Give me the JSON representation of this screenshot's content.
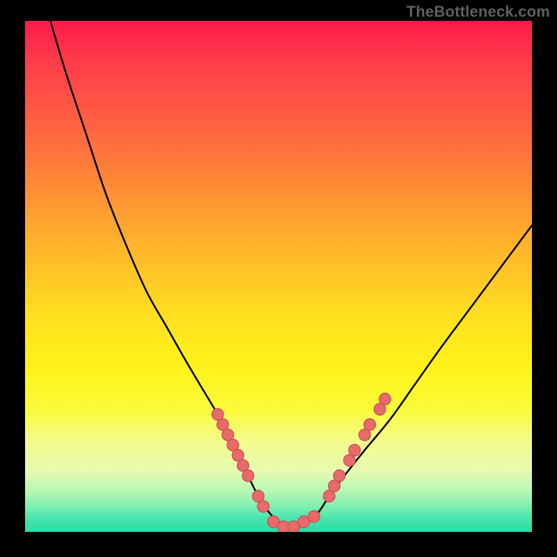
{
  "watermark": "TheBottleneck.com",
  "colors": {
    "background_frame": "#000000",
    "curve_stroke": "#000000",
    "dot_fill": "#e86a6a",
    "dot_stroke": "#c94f4f",
    "watermark_text": "#5f5f5f"
  },
  "chart_data": {
    "type": "line",
    "title": "",
    "xlabel": "",
    "ylabel": "",
    "xlim": [
      0,
      100
    ],
    "ylim": [
      0,
      100
    ],
    "grid": false,
    "series": [
      {
        "name": "curve",
        "x": [
          5,
          8,
          12,
          16,
          20,
          24,
          28,
          32,
          35,
          38,
          40,
          42,
          44,
          46,
          48,
          50,
          52,
          54,
          56,
          58,
          60,
          63,
          67,
          72,
          77,
          82,
          88,
          94,
          100
        ],
        "values": [
          100,
          90,
          78,
          66,
          56,
          47,
          40,
          33,
          28,
          23,
          19,
          15,
          11,
          7,
          4,
          2,
          1,
          1,
          2,
          4,
          7,
          11,
          16,
          22,
          29,
          36,
          44,
          52,
          60
        ]
      }
    ],
    "dots": {
      "left": [
        {
          "x": 38,
          "y": 23
        },
        {
          "x": 39,
          "y": 21
        },
        {
          "x": 40,
          "y": 19
        },
        {
          "x": 41,
          "y": 17
        },
        {
          "x": 42,
          "y": 15
        },
        {
          "x": 43,
          "y": 13
        },
        {
          "x": 44,
          "y": 11
        },
        {
          "x": 46,
          "y": 7
        },
        {
          "x": 47,
          "y": 5
        }
      ],
      "bottom": [
        {
          "x": 49,
          "y": 2
        },
        {
          "x": 51,
          "y": 1
        },
        {
          "x": 53,
          "y": 1
        },
        {
          "x": 55,
          "y": 2
        },
        {
          "x": 57,
          "y": 3
        }
      ],
      "right": [
        {
          "x": 60,
          "y": 7
        },
        {
          "x": 61,
          "y": 9
        },
        {
          "x": 62,
          "y": 11
        },
        {
          "x": 64,
          "y": 14
        },
        {
          "x": 65,
          "y": 16
        },
        {
          "x": 67,
          "y": 19
        },
        {
          "x": 68,
          "y": 21
        },
        {
          "x": 70,
          "y": 24
        },
        {
          "x": 71,
          "y": 26
        }
      ]
    },
    "notes": "V-shaped curve on vertical rainbow gradient; minimum near x≈52; left descends from upper-left, right ascends to mid-right; salmon dots cluster on lower segments and floor of curve."
  }
}
